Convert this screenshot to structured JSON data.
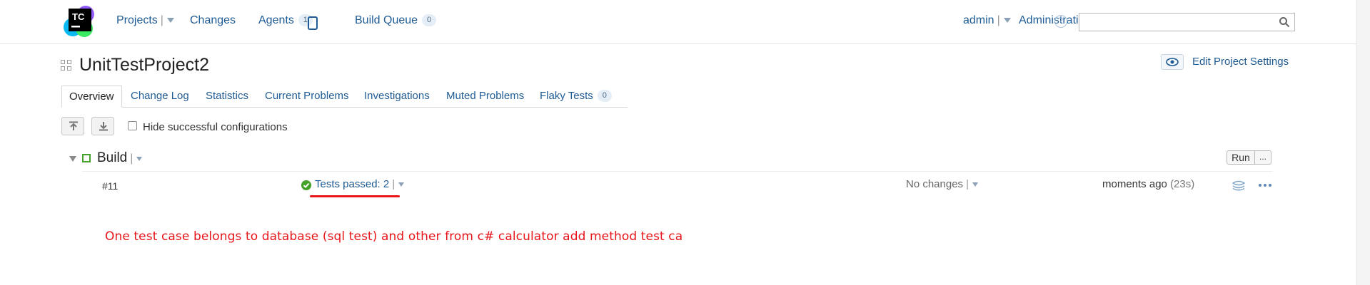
{
  "header": {
    "logo_text": "TC",
    "nav": {
      "projects": "Projects",
      "changes": "Changes",
      "agents": "Agents",
      "agents_count": "1",
      "build_queue": "Build Queue",
      "build_queue_count": "0"
    },
    "user": "admin",
    "administration": "Administration",
    "help": "?",
    "search": {
      "value": "",
      "placeholder": ""
    }
  },
  "project": {
    "title": "UnitTestProject2",
    "edit_settings": "Edit Project Settings"
  },
  "tabs": [
    {
      "label": "Overview",
      "active": true
    },
    {
      "label": "Change Log"
    },
    {
      "label": "Statistics"
    },
    {
      "label": "Current Problems"
    },
    {
      "label": "Investigations"
    },
    {
      "label": "Muted Problems"
    },
    {
      "label": "Flaky Tests",
      "count": "0"
    }
  ],
  "toolbar": {
    "hide_successful_label": "Hide successful configurations",
    "hide_successful_checked": false
  },
  "build_config": {
    "name": "Build",
    "run_label": "Run",
    "run_more_label": "...",
    "last_build": {
      "number": "#11",
      "status": "Tests passed: 2",
      "changes": "No changes",
      "time": "moments ago",
      "duration": "(23s)"
    }
  },
  "annotation": "One test case belongs to database (sql test) and other from c# calculator add method test ca",
  "colors": {
    "link": "#1f5b94",
    "success": "#44a22b",
    "annotation": "#e8141a"
  }
}
